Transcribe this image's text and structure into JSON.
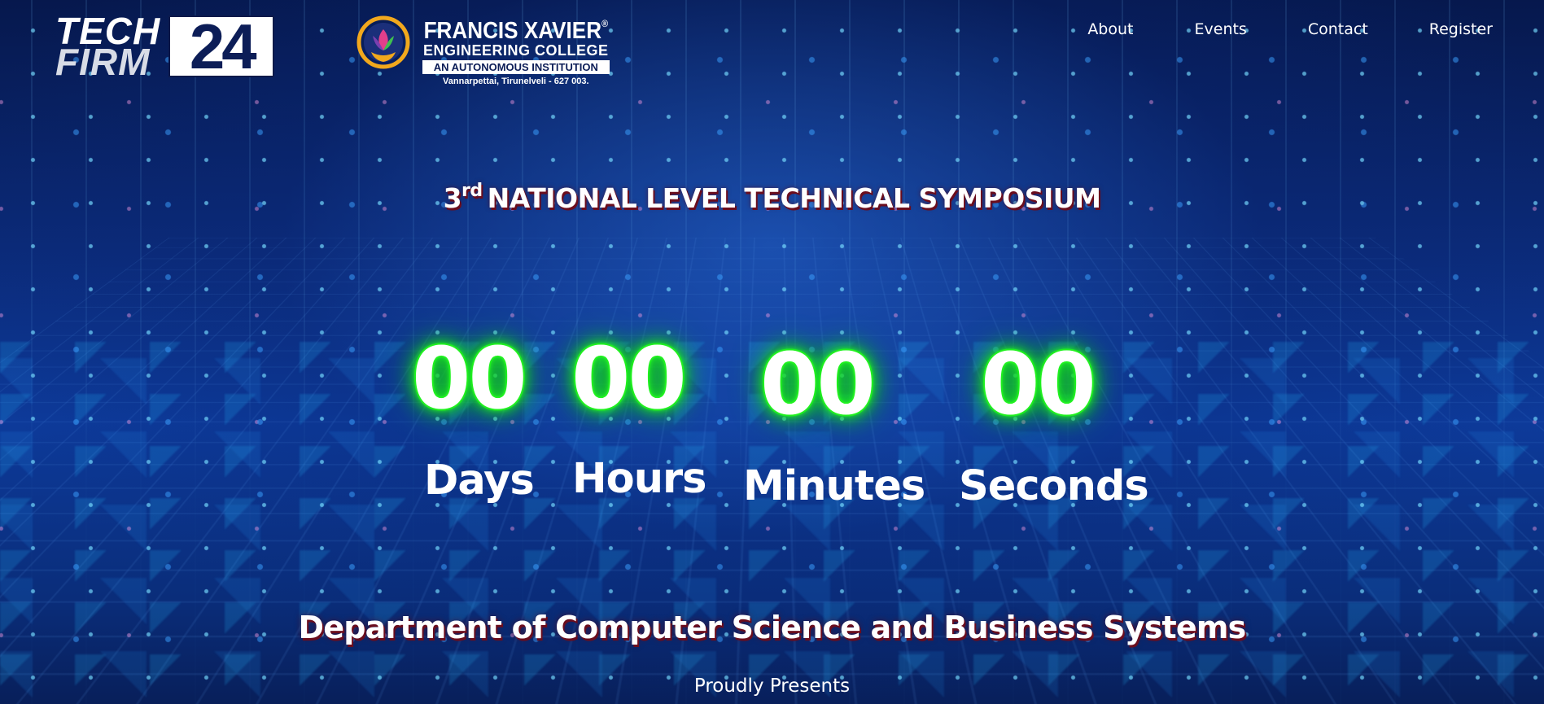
{
  "header": {
    "brand": {
      "word_top": "TECH",
      "word_bottom": "FIRM",
      "year": "24"
    },
    "college": {
      "name": "FRANCIS XAVIER",
      "registered_mark": "®",
      "subtitle": "ENGINEERING COLLEGE",
      "badge": "AN AUTONOMOUS INSTITUTION",
      "address": "Vannarpettai, Tirunelveli - 627 003."
    },
    "nav": {
      "items": [
        {
          "label": "About"
        },
        {
          "label": "Events"
        },
        {
          "label": "Contact"
        },
        {
          "label": "Register"
        }
      ]
    }
  },
  "hero": {
    "ordinal_number": "3",
    "ordinal_suffix": "rd",
    "symposium_title": "NATIONAL LEVEL TECHNICAL SYMPOSIUM",
    "countdown": {
      "days": {
        "value": "00",
        "label": "Days"
      },
      "hours": {
        "value": "00",
        "label": "Hours"
      },
      "minutes": {
        "value": "00",
        "label": "Minutes"
      },
      "seconds": {
        "value": "00",
        "label": "Seconds"
      }
    },
    "department": "Department of Computer Science and Business Systems",
    "presents": "Proudly Presents"
  },
  "colors": {
    "countdown_glow": "#25f025",
    "heading_shadow": "#6b0d1d",
    "background_primary": "#0b2a78",
    "brand_navy": "#0c1d57"
  }
}
